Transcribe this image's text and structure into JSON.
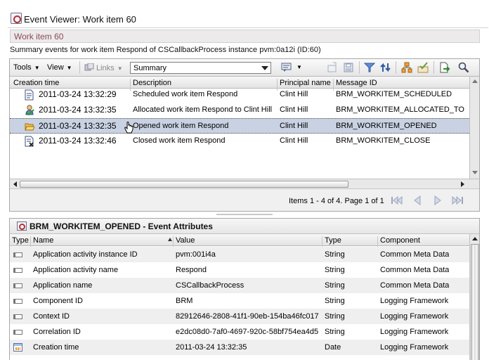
{
  "window": {
    "title": "Event Viewer: Work item 60"
  },
  "work_item": {
    "label": "Work item 60"
  },
  "summary_text": "Summary events for work item Respond of CSCallbackProcess instance pvm:0a12i (ID:60)",
  "toolbar": {
    "tools_label": "Tools",
    "view_label": "View",
    "links_label": "Links",
    "view_mode_value": "Summary"
  },
  "events_table": {
    "columns": [
      "Creation time",
      "Description",
      "Principal name",
      "Message ID"
    ],
    "rows": [
      {
        "time": "2011-03-24 13:32:29",
        "description": "Scheduled work item Respond",
        "principal": "Clint Hill",
        "message_id": "BRM_WORKITEM_SCHEDULED",
        "icon": "scheduled-icon"
      },
      {
        "time": "2011-03-24 13:32:35",
        "description": "Allocated work item Respond to Clint Hill",
        "principal": "Clint Hill",
        "message_id": "BRM_WORKITEM_ALLOCATED_TO",
        "icon": "allocated-icon"
      },
      {
        "time": "2011-03-24 13:32:35",
        "description": "Opened work item Respond",
        "principal": "Clint Hill",
        "message_id": "BRM_WORKITEM_OPENED",
        "icon": "folder-open-icon",
        "selected": true
      },
      {
        "time": "2011-03-24 13:32:46",
        "description": "Closed work item Respond",
        "principal": "Clint Hill",
        "message_id": "BRM_WORKITEM_CLOSE",
        "icon": "closed-icon"
      }
    ]
  },
  "pager": {
    "text": "Items 1 - 4 of 4. Page 1 of 1"
  },
  "attributes_panel": {
    "title": "BRM_WORKITEM_OPENED - Event Attributes",
    "columns": [
      "Type",
      "Name",
      "Value",
      "Type",
      "Component"
    ],
    "rows": [
      {
        "name": "Application activity instance ID",
        "value": "pvm:001i4a",
        "type": "String",
        "component": "Common Meta Data"
      },
      {
        "name": "Application activity name",
        "value": "Respond",
        "type": "String",
        "component": "Common Meta Data"
      },
      {
        "name": "Application name",
        "value": "CSCallbackProcess",
        "type": "String",
        "component": "Common Meta Data"
      },
      {
        "name": "Component ID",
        "value": "BRM",
        "type": "String",
        "component": "Logging Framework"
      },
      {
        "name": "Context ID",
        "value": "82912646-2808-41f1-90eb-154ba46fc017",
        "type": "String",
        "component": "Logging Framework"
      },
      {
        "name": "Correlation ID",
        "value": "e2dc08d0-7af0-4697-920c-58bf754ea4d5",
        "type": "String",
        "component": "Logging Framework"
      },
      {
        "name": "Creation time",
        "value": "2011-03-24 13:32:35",
        "type": "Date",
        "component": "Logging Framework"
      }
    ]
  },
  "colors": {
    "accent": "#8c4b58",
    "selection": "#c9d2e2",
    "alt_row": "#efefef"
  }
}
